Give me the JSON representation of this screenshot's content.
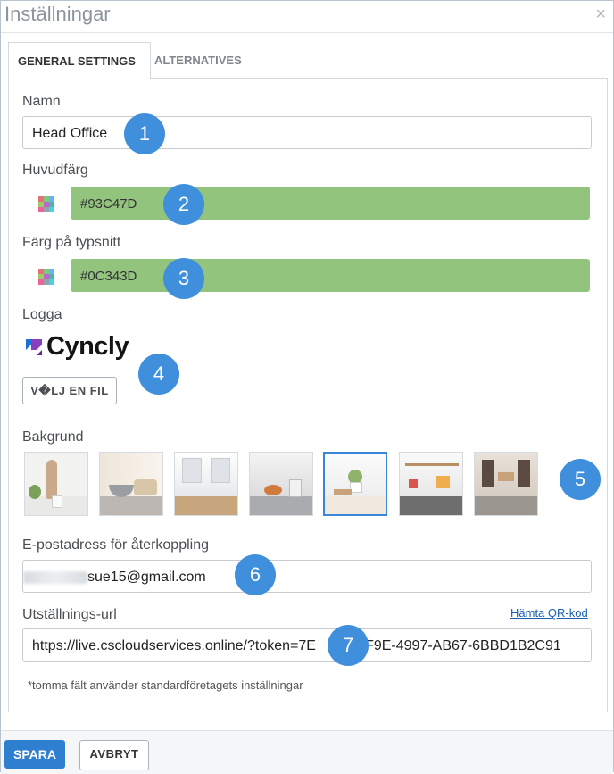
{
  "dialog": {
    "title": "Inställningar",
    "close_symbol": "×"
  },
  "tabs": [
    {
      "label": "GENERAL SETTINGS",
      "active": true
    },
    {
      "label": "ALTERNATIVES",
      "active": false
    }
  ],
  "form": {
    "name": {
      "label": "Namn",
      "value": "Head Office"
    },
    "main_color": {
      "label": "Huvudfärg",
      "value": "#93C47D",
      "swatch": "#93C47D"
    },
    "font_color": {
      "label": "Färg på typsnitt",
      "value": "#0C343D",
      "swatch": "#93C47D"
    },
    "logo": {
      "label": "Logga",
      "logo_text": "Cyncly",
      "choose_file_label": "V�LJ EN FIL"
    },
    "background": {
      "label": "Bakgrund",
      "selected_index": 4,
      "thumbnail_count": 7
    },
    "feedback_email": {
      "label": "E-postadress för återkoppling",
      "value": "sue15@gmail.com"
    },
    "showroom_url": {
      "label": "Utställnings-url",
      "value": "https://live.cscloudservices.online/?token=7E",
      "value_tail": "3-8F9E-4997-AB67-6BBD1B2C91",
      "qr_link": "Hämta QR-kod"
    },
    "note": "*tomma fält använder standardföretagets inställningar"
  },
  "callouts": [
    "1",
    "2",
    "3",
    "4",
    "5",
    "6",
    "7"
  ],
  "footer": {
    "save_label": "SPARA",
    "cancel_label": "AVBRYT"
  },
  "colors": {
    "accent": "#2F7FD1",
    "callout": "#3F8FDC",
    "logo_purple": "#5B2D91",
    "logo_blue": "#1E6FD9"
  },
  "icons": [
    "close-icon",
    "color-palette-icon",
    "cyncly-logo-icon"
  ]
}
